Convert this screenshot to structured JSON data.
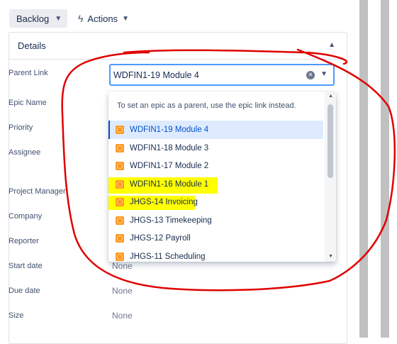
{
  "toolbar": {
    "backlog_label": "Backlog",
    "actions_label": "Actions"
  },
  "details": {
    "title": "Details",
    "fields": {
      "parent_link": "Parent Link",
      "epic_name": "Epic Name",
      "priority": "Priority",
      "assignee": "Assignee",
      "project_manager": "Project Manager",
      "company": "Company",
      "reporter": "Reporter",
      "start_date": "Start date",
      "due_date": "Due date",
      "size": "Size"
    },
    "values": {
      "start_date": "None",
      "due_date": "None",
      "size": "None"
    }
  },
  "parent_select": {
    "value": "WDFIN1-19 Module 4",
    "hint": "To set an epic as a parent, use the epic link instead.",
    "options": [
      {
        "label": "WDFIN1-19 Module 4"
      },
      {
        "label": "WDFIN1-18 Module 3"
      },
      {
        "label": "WDFIN1-17 Module 2"
      },
      {
        "label": "WDFIN1-16 Module 1"
      },
      {
        "label": "JHGS-14 Invoicing"
      },
      {
        "label": "JHGS-13 Timekeeping"
      },
      {
        "label": "JHGS-12 Payroll"
      },
      {
        "label": "JHGS-11 Scheduling"
      }
    ],
    "selected_index": 0,
    "highlighted_options": [
      "WDFIN1-16 Module 1",
      "JHGS-14 Invoicing"
    ]
  },
  "colors": {
    "accent": "#0052cc",
    "focus_border": "#4c9aff",
    "selected_bg": "#deebff",
    "epic_icon": "#ff991f",
    "highlight": "#ffff00",
    "annotation": "#e00000"
  },
  "icons": {
    "backlog_chevron": "chevron-down-icon",
    "actions": "lightning-icon",
    "collapse": "chevron-up-icon",
    "clear": "clear-icon",
    "epic": "epic-icon"
  }
}
